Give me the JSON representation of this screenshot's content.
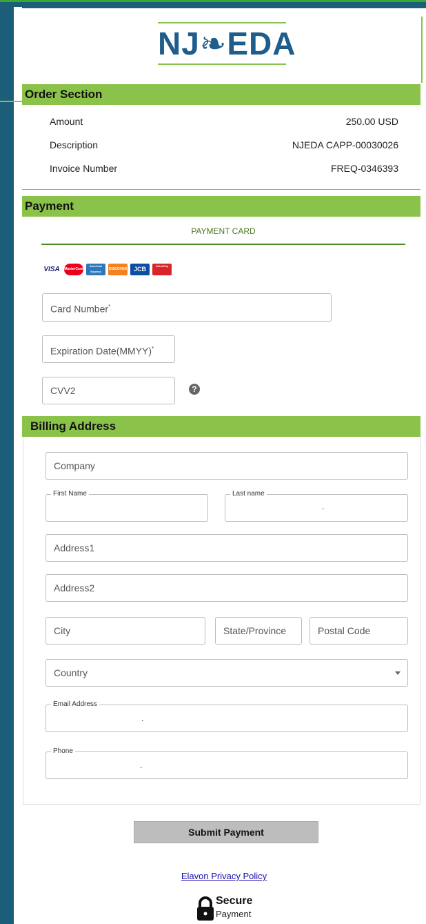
{
  "logo": {
    "text": "NJ❧EDA",
    "brand_color": "#1f5d8c",
    "accent_color": "#8bc34a"
  },
  "order": {
    "heading": "Order Section",
    "rows": [
      {
        "label": "Amount",
        "value": "250.00 USD"
      },
      {
        "label": "Description",
        "value": "NJEDA CAPP-00030026"
      },
      {
        "label": "Invoice Number",
        "value": "FREQ-0346393"
      }
    ]
  },
  "payment": {
    "heading": "Payment",
    "tab_label": "PAYMENT CARD",
    "card_brands": [
      "VISA",
      "MasterCard",
      "American Express",
      "DISCOVER",
      "JCB",
      "UnionPay"
    ],
    "card_number_placeholder": "Card Number",
    "expiration_placeholder": "Expiration Date(MMYY)",
    "required_mark": "*",
    "cvv_placeholder": "CVV2",
    "help_icon": "?"
  },
  "billing": {
    "heading": "Billing Address",
    "company_placeholder": "Company",
    "first_name_label": "First Name",
    "last_name_label": "Last name",
    "address1_placeholder": "Address1",
    "address2_placeholder": "Address2",
    "city_placeholder": "City",
    "state_placeholder": "State/Province",
    "postal_placeholder": "Postal Code",
    "country_placeholder": "Country",
    "email_label": "Email Address",
    "phone_label": "Phone",
    "masked_value": "."
  },
  "actions": {
    "submit_label": "Submit Payment",
    "privacy_link": "Elavon Privacy Policy"
  },
  "secure": {
    "title": "Secure",
    "subtitle": "Payment",
    "icon": "lock-icon"
  },
  "colors": {
    "section_bar": "#8bc34a",
    "frame": "#1c5e7a",
    "tab_accent": "#4c8b2b",
    "link": "#1a0dab"
  }
}
